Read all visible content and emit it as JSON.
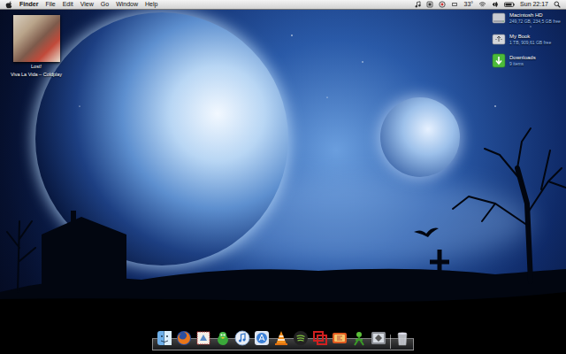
{
  "menu_bar": {
    "app": "Finder",
    "menus": [
      "File",
      "Edit",
      "View",
      "Go",
      "Window",
      "Help"
    ],
    "status": {
      "temperature": "33°",
      "clock": "Sun 22:17"
    }
  },
  "now_playing": {
    "track": "Lost!",
    "artist_album": "Viva La Vida – Coldplay"
  },
  "desktop_icons": [
    {
      "label": "Macintosh HD",
      "info": "249,72 GB, 234,5 GB free",
      "kind": "disk"
    },
    {
      "label": "My Book",
      "info": "1 TB, 909,61 GB free",
      "kind": "usb"
    },
    {
      "label": "Downloads",
      "info": "9 items",
      "kind": "folder"
    }
  ]
}
